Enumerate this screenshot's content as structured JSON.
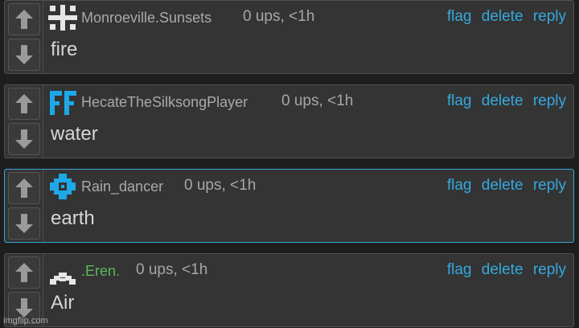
{
  "comments": [
    {
      "avatar": "pixel-cross-icon",
      "username": "Monroeville.Sunsets",
      "username_color": "#a9a9a9",
      "meta": "0 ups, <1h",
      "actions": {
        "flag": "flag",
        "delete": "delete",
        "reply": "reply"
      },
      "text": "fire"
    },
    {
      "avatar": "pixel-ff-icon",
      "username": "HecateTheSilksongPlayer",
      "username_color": "#a9a9a9",
      "meta": "0 ups, <1h",
      "actions": {
        "flag": "flag",
        "delete": "delete",
        "reply": "reply"
      },
      "text": "water"
    },
    {
      "avatar": "pixel-diamond-icon",
      "username": "Rain_dancer",
      "username_color": "#a9a9a9",
      "meta": "0 ups, <1h",
      "actions": {
        "flag": "flag",
        "delete": "delete",
        "reply": "reply"
      },
      "text": "earth",
      "highlighted": true
    },
    {
      "avatar": "pixel-invader-icon",
      "username": ".Eren.",
      "username_color": "#5cb85c",
      "meta": "0 ups, <1h",
      "actions": {
        "flag": "flag",
        "delete": "delete",
        "reply": "reply"
      },
      "text": "Air"
    }
  ],
  "watermark": "imgflip.com",
  "colors": {
    "link": "#35a8de",
    "highlight_border": "#3aa6d6",
    "background": "#343434",
    "arrow": "#9a9a9a"
  },
  "icons": {
    "upvote": "arrow-up-icon",
    "downvote": "arrow-down-icon"
  }
}
